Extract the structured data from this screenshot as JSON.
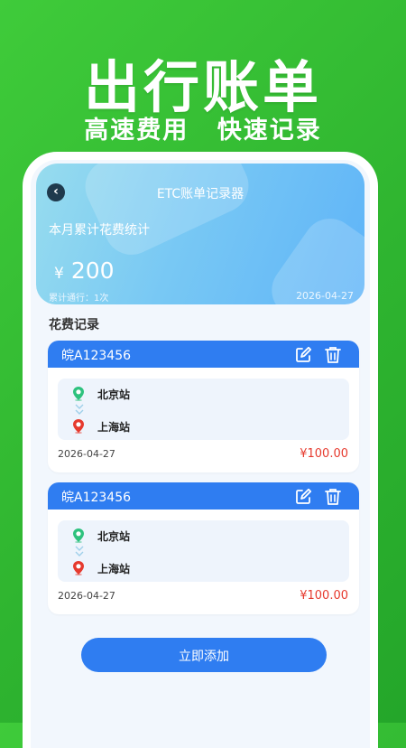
{
  "hero": {
    "title": "出行账单",
    "subtitle_left": "高速费用",
    "subtitle_right": "快速记录"
  },
  "header": {
    "back_label": "‹",
    "title": "ETC账单记录器",
    "stat_label": "本月累计花费统计",
    "currency": "¥",
    "amount": "200",
    "count": "累计通行：1次",
    "date": "2026-04-27"
  },
  "records_title": "花费记录",
  "records": [
    {
      "plate": "皖A123456",
      "from": "北京站",
      "to": "上海站",
      "date": "2026-04-27",
      "amount": "¥100.00"
    },
    {
      "plate": "皖A123456",
      "from": "北京站",
      "to": "上海站",
      "date": "2026-04-27",
      "amount": "¥100.00"
    }
  ],
  "add_button": "立即添加",
  "colors": {
    "background": "#2fb530",
    "accent": "#2f7df1",
    "amount_red": "#e63a2e",
    "start_pin": "#2ec27e",
    "end_pin": "#e63a2e"
  },
  "icons": [
    "back-icon",
    "edit-icon",
    "trash-icon",
    "start-pin-icon",
    "end-pin-icon",
    "double-chevron-down-icon"
  ]
}
